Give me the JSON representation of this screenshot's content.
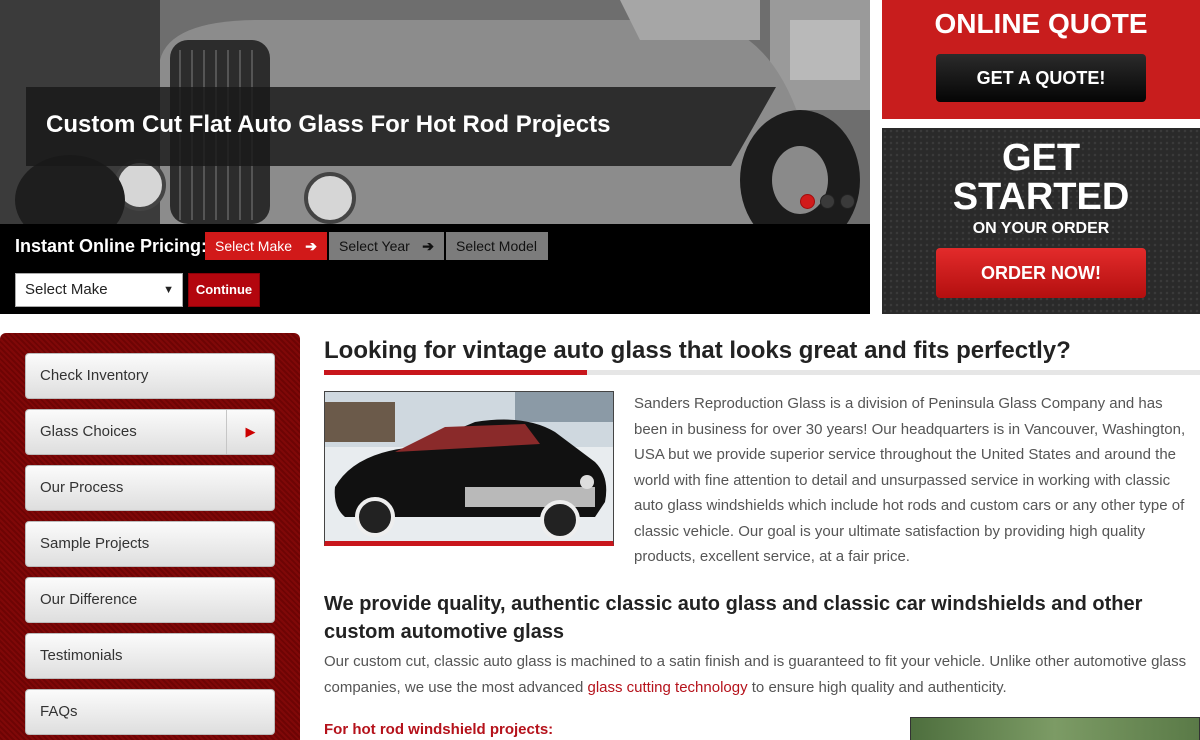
{
  "hero": {
    "caption": "Custom Cut Flat Auto Glass For Hot Rod Projects",
    "slides": 3,
    "active_slide": 1
  },
  "pricing": {
    "label": "Instant Online Pricing:",
    "steps": [
      "Select Make",
      "Select Year",
      "Select Model"
    ],
    "step_arrow": "➔",
    "make_select_value": "Select Make",
    "continue_label": "Continue"
  },
  "quote": {
    "title": "ONLINE QUOTE",
    "button": "GET A QUOTE!"
  },
  "started": {
    "line1": "GET",
    "line2": "STARTED",
    "line3": "ON YOUR ORDER",
    "button": "ORDER NOW!"
  },
  "sidebar": {
    "items": [
      {
        "label": "Check Inventory"
      },
      {
        "label": "Glass Choices",
        "has_submenu": true
      },
      {
        "label": "Our Process"
      },
      {
        "label": "Sample Projects"
      },
      {
        "label": "Our Difference"
      },
      {
        "label": "Testimonials"
      },
      {
        "label": "FAQs"
      }
    ]
  },
  "content": {
    "heading": "Looking for vintage auto glass that looks great and fits perfectly?",
    "intro": "Sanders Reproduction Glass is a division of Peninsula Glass Company and has been in business for over 30 years! Our headquarters is in Vancouver, Washington, USA but we provide superior service throughout the United States and around the world with fine attention to detail and unsurpassed service in working with classic auto glass windshields which include hot rods and custom cars or any other type of classic vehicle. Our goal is your ultimate satisfaction by providing high quality products, excellent service, at a fair price.",
    "subheading": "We provide quality, authentic classic auto glass and classic car windshields and other custom automotive glass",
    "para2_before": "Our custom cut, classic auto glass is machined to a satin finish and is guaranteed to fit your vehicle. Unlike other automotive glass companies, we use the most advanced ",
    "para2_link": "glass cutting technology",
    "para2_after": " to ensure high quality and authenticity.",
    "hotrod_heading": "For hot rod windshield projects:"
  },
  "colors": {
    "brand_red": "#c81d1d",
    "link_red": "#b5121b",
    "sidebar_red": "#7a0606"
  }
}
